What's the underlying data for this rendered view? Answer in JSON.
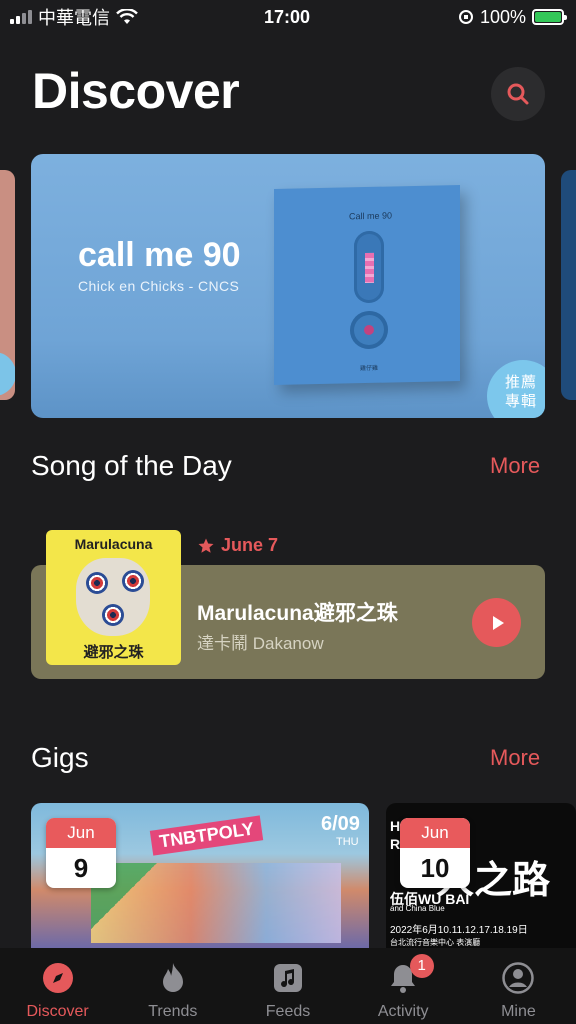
{
  "status_bar": {
    "carrier": "中華電信",
    "time": "17:00",
    "battery": "100%"
  },
  "header": {
    "title": "Discover"
  },
  "banner": {
    "title": "call me 90",
    "subtitle": "Chick en Chicks - CNCS",
    "album_label": "Call me 90",
    "album_slot_text": "C N C S",
    "album_mark": "雞仔雞",
    "badge_line1": "推薦",
    "badge_line2": "專輯"
  },
  "song_of_day": {
    "section_title": "Song of the Day",
    "more_label": "More",
    "date": "June 7",
    "song_title": "Marulacuna避邪之珠",
    "artist": "達卡鬧 Dakanow",
    "cover_top": "Marulacuna",
    "cover_bottom": "避邪之珠"
  },
  "gigs": {
    "section_title": "Gigs",
    "more_label": "More",
    "items": [
      {
        "month": "Jun",
        "day": "9",
        "poster_text": "TNBTPOLY",
        "poster_date": "6/09",
        "poster_weekday": "THU"
      },
      {
        "month": "Jun",
        "day": "10",
        "poster_head": "H  E A\nR  R",
        "poster_big": "人之路",
        "poster_name": "伍佰WU BAI",
        "poster_sub": "and China Blue",
        "poster_dates": "2022年6月10.11.12.17.18.19日",
        "poster_venue": "台北流行音樂中心 表演廳"
      }
    ]
  },
  "tabs": [
    {
      "label": "Discover",
      "icon": "compass-icon",
      "active": true
    },
    {
      "label": "Trends",
      "icon": "flame-icon"
    },
    {
      "label": "Feeds",
      "icon": "music-note-icon"
    },
    {
      "label": "Activity",
      "icon": "bell-icon",
      "badge": "1"
    },
    {
      "label": "Mine",
      "icon": "person-icon"
    }
  ],
  "colors": {
    "accent": "#e5595b",
    "background": "#1c1c1e",
    "banner": "#7db0de",
    "song_card": "#7a7658"
  }
}
